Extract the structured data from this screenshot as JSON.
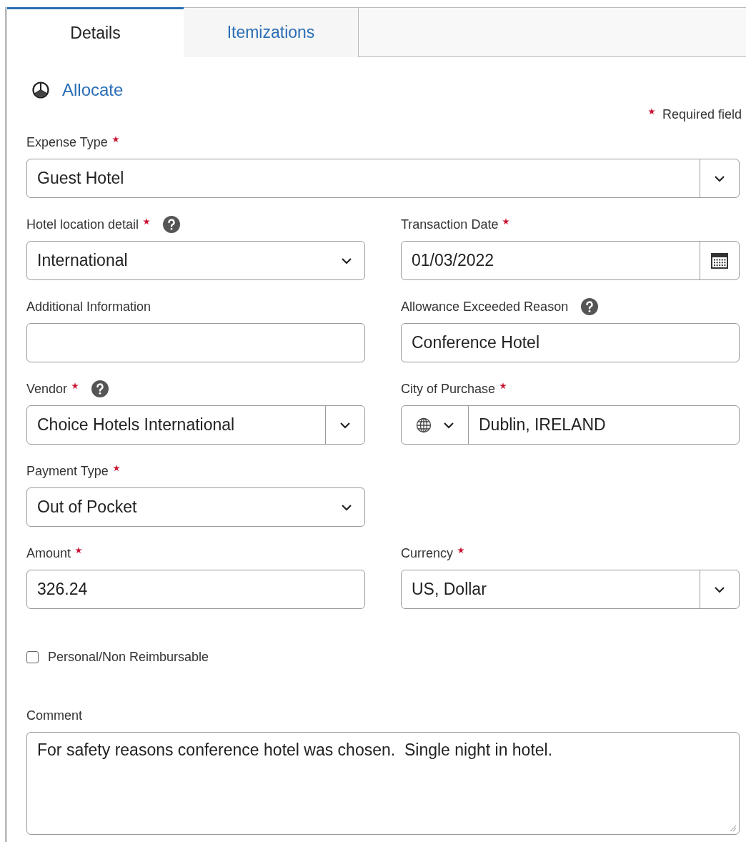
{
  "tabs": [
    {
      "label": "Details",
      "selected": true
    },
    {
      "label": "Itemizations",
      "selected": false
    }
  ],
  "allocate": {
    "label": "Allocate"
  },
  "required_note": "Required field",
  "rows": [
    {
      "fields": [
        {
          "kind": "select_split",
          "label": "Expense Type",
          "required": true,
          "help": false,
          "value": "Guest Hotel",
          "wide": true
        }
      ]
    },
    {
      "fields": [
        {
          "kind": "select",
          "label": "Hotel location detail",
          "required": true,
          "help": true,
          "value": "International"
        },
        {
          "kind": "date",
          "label": "Transaction Date",
          "required": true,
          "help": false,
          "value": "01/03/2022"
        }
      ]
    },
    {
      "fields": [
        {
          "kind": "text",
          "label": "Additional Information",
          "required": false,
          "help": false
        },
        {
          "kind": "text",
          "label": "Allowance Exceeded Reason",
          "required": false,
          "help": true,
          "value": "Conference Hotel"
        }
      ]
    },
    {
      "fields": [
        {
          "kind": "select_split",
          "label": "Vendor",
          "required": true,
          "help": true,
          "value": "Choice Hotels International"
        },
        {
          "kind": "city",
          "label": "City of Purchase",
          "required": true,
          "help": false,
          "value": "Dublin, IRELAND"
        }
      ]
    },
    {
      "fields": [
        {
          "kind": "select",
          "label": "Payment Type",
          "required": true,
          "help": false,
          "value": "Out of Pocket"
        }
      ]
    },
    {
      "fields": [
        {
          "kind": "text",
          "label": "Amount",
          "required": true,
          "help": false,
          "value": "326.24"
        },
        {
          "kind": "select_split",
          "label": "Currency",
          "required": true,
          "help": false,
          "value": "US, Dollar"
        }
      ]
    }
  ],
  "personal": {
    "label": "Personal/Non Reimbursable",
    "checked": false
  },
  "comment": {
    "label": "Comment",
    "value": "For safety reasons conference hotel was chosen.  Single night in hotel."
  }
}
